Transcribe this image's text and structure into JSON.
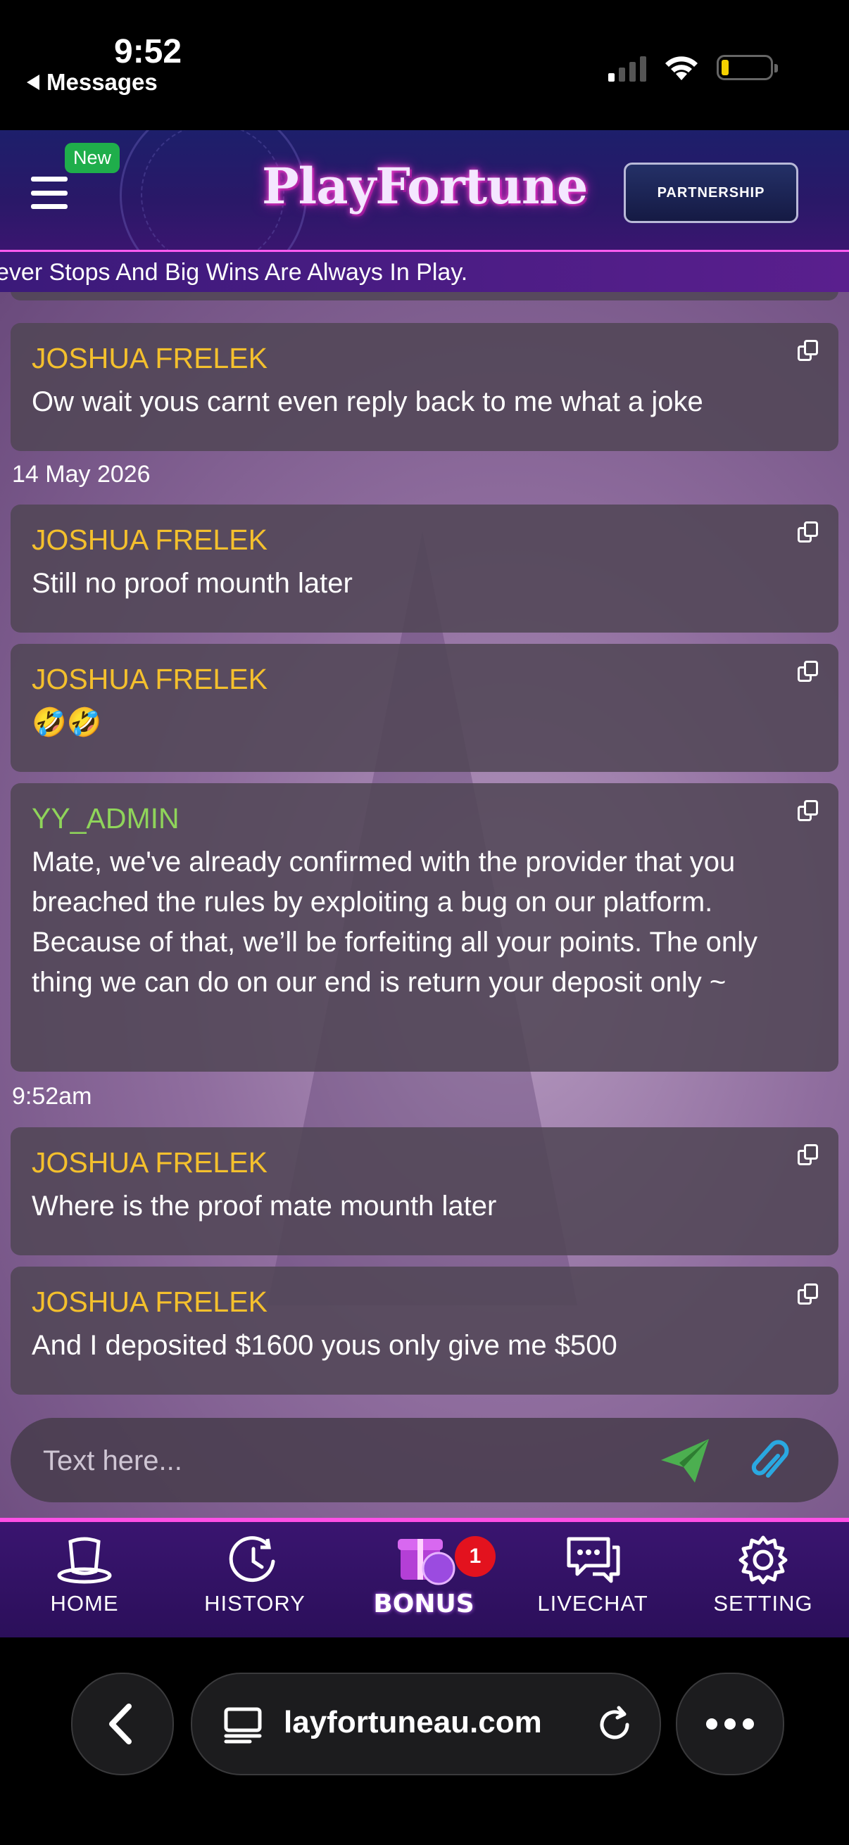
{
  "status_bar": {
    "time": "9:52",
    "back_app": "Messages"
  },
  "header": {
    "new_badge": "New",
    "logo_text": "PlayFortune",
    "partnership_text": "PARTNERSHIP",
    "marquee": "ever Stops And Big Wins Are Always In Play."
  },
  "chat": {
    "messages": [
      {
        "name": "JOSHUA FRELEK",
        "text": "Ow wait yous carnt even reply back to me what a joke"
      },
      {
        "name": "JOSHUA FRELEK",
        "text": "Still no proof mounth later"
      },
      {
        "name": "JOSHUA FRELEK",
        "text": "🤣🤣"
      },
      {
        "name": "YY_ADMIN",
        "text": "Mate, we've already confirmed with the provider that you breached the rules by exploiting a bug on our platform. Because of that, we’ll be forfeiting all your points. The only thing we can do on our end is return your deposit only ~"
      },
      {
        "name": "JOSHUA FRELEK",
        "text": "Where is the proof mate mounth later"
      },
      {
        "name": "JOSHUA FRELEK",
        "text": "And I deposited $1600 yous only give me $500"
      }
    ],
    "date_separator": "14 May 2026",
    "time_separator": "9:52am",
    "input_placeholder": "Text here..."
  },
  "bottom_nav": {
    "items": [
      {
        "label": "HOME",
        "icon": "top-hat-icon"
      },
      {
        "label": "HISTORY",
        "icon": "history-clock-icon"
      },
      {
        "label": "BONUS",
        "icon": "gift-icon",
        "badge": "1"
      },
      {
        "label": "LIVECHAT",
        "icon": "chat-bubbles-icon"
      },
      {
        "label": "SETTING",
        "icon": "gear-icon"
      }
    ]
  },
  "browser": {
    "url": "layfortuneau.com"
  },
  "colors": {
    "user_name": "#f4c02d",
    "admin_name": "#8fd45a",
    "accent_pink": "#ff4fe6",
    "send_green": "#4caf50",
    "clip_blue": "#2aa8e0"
  }
}
